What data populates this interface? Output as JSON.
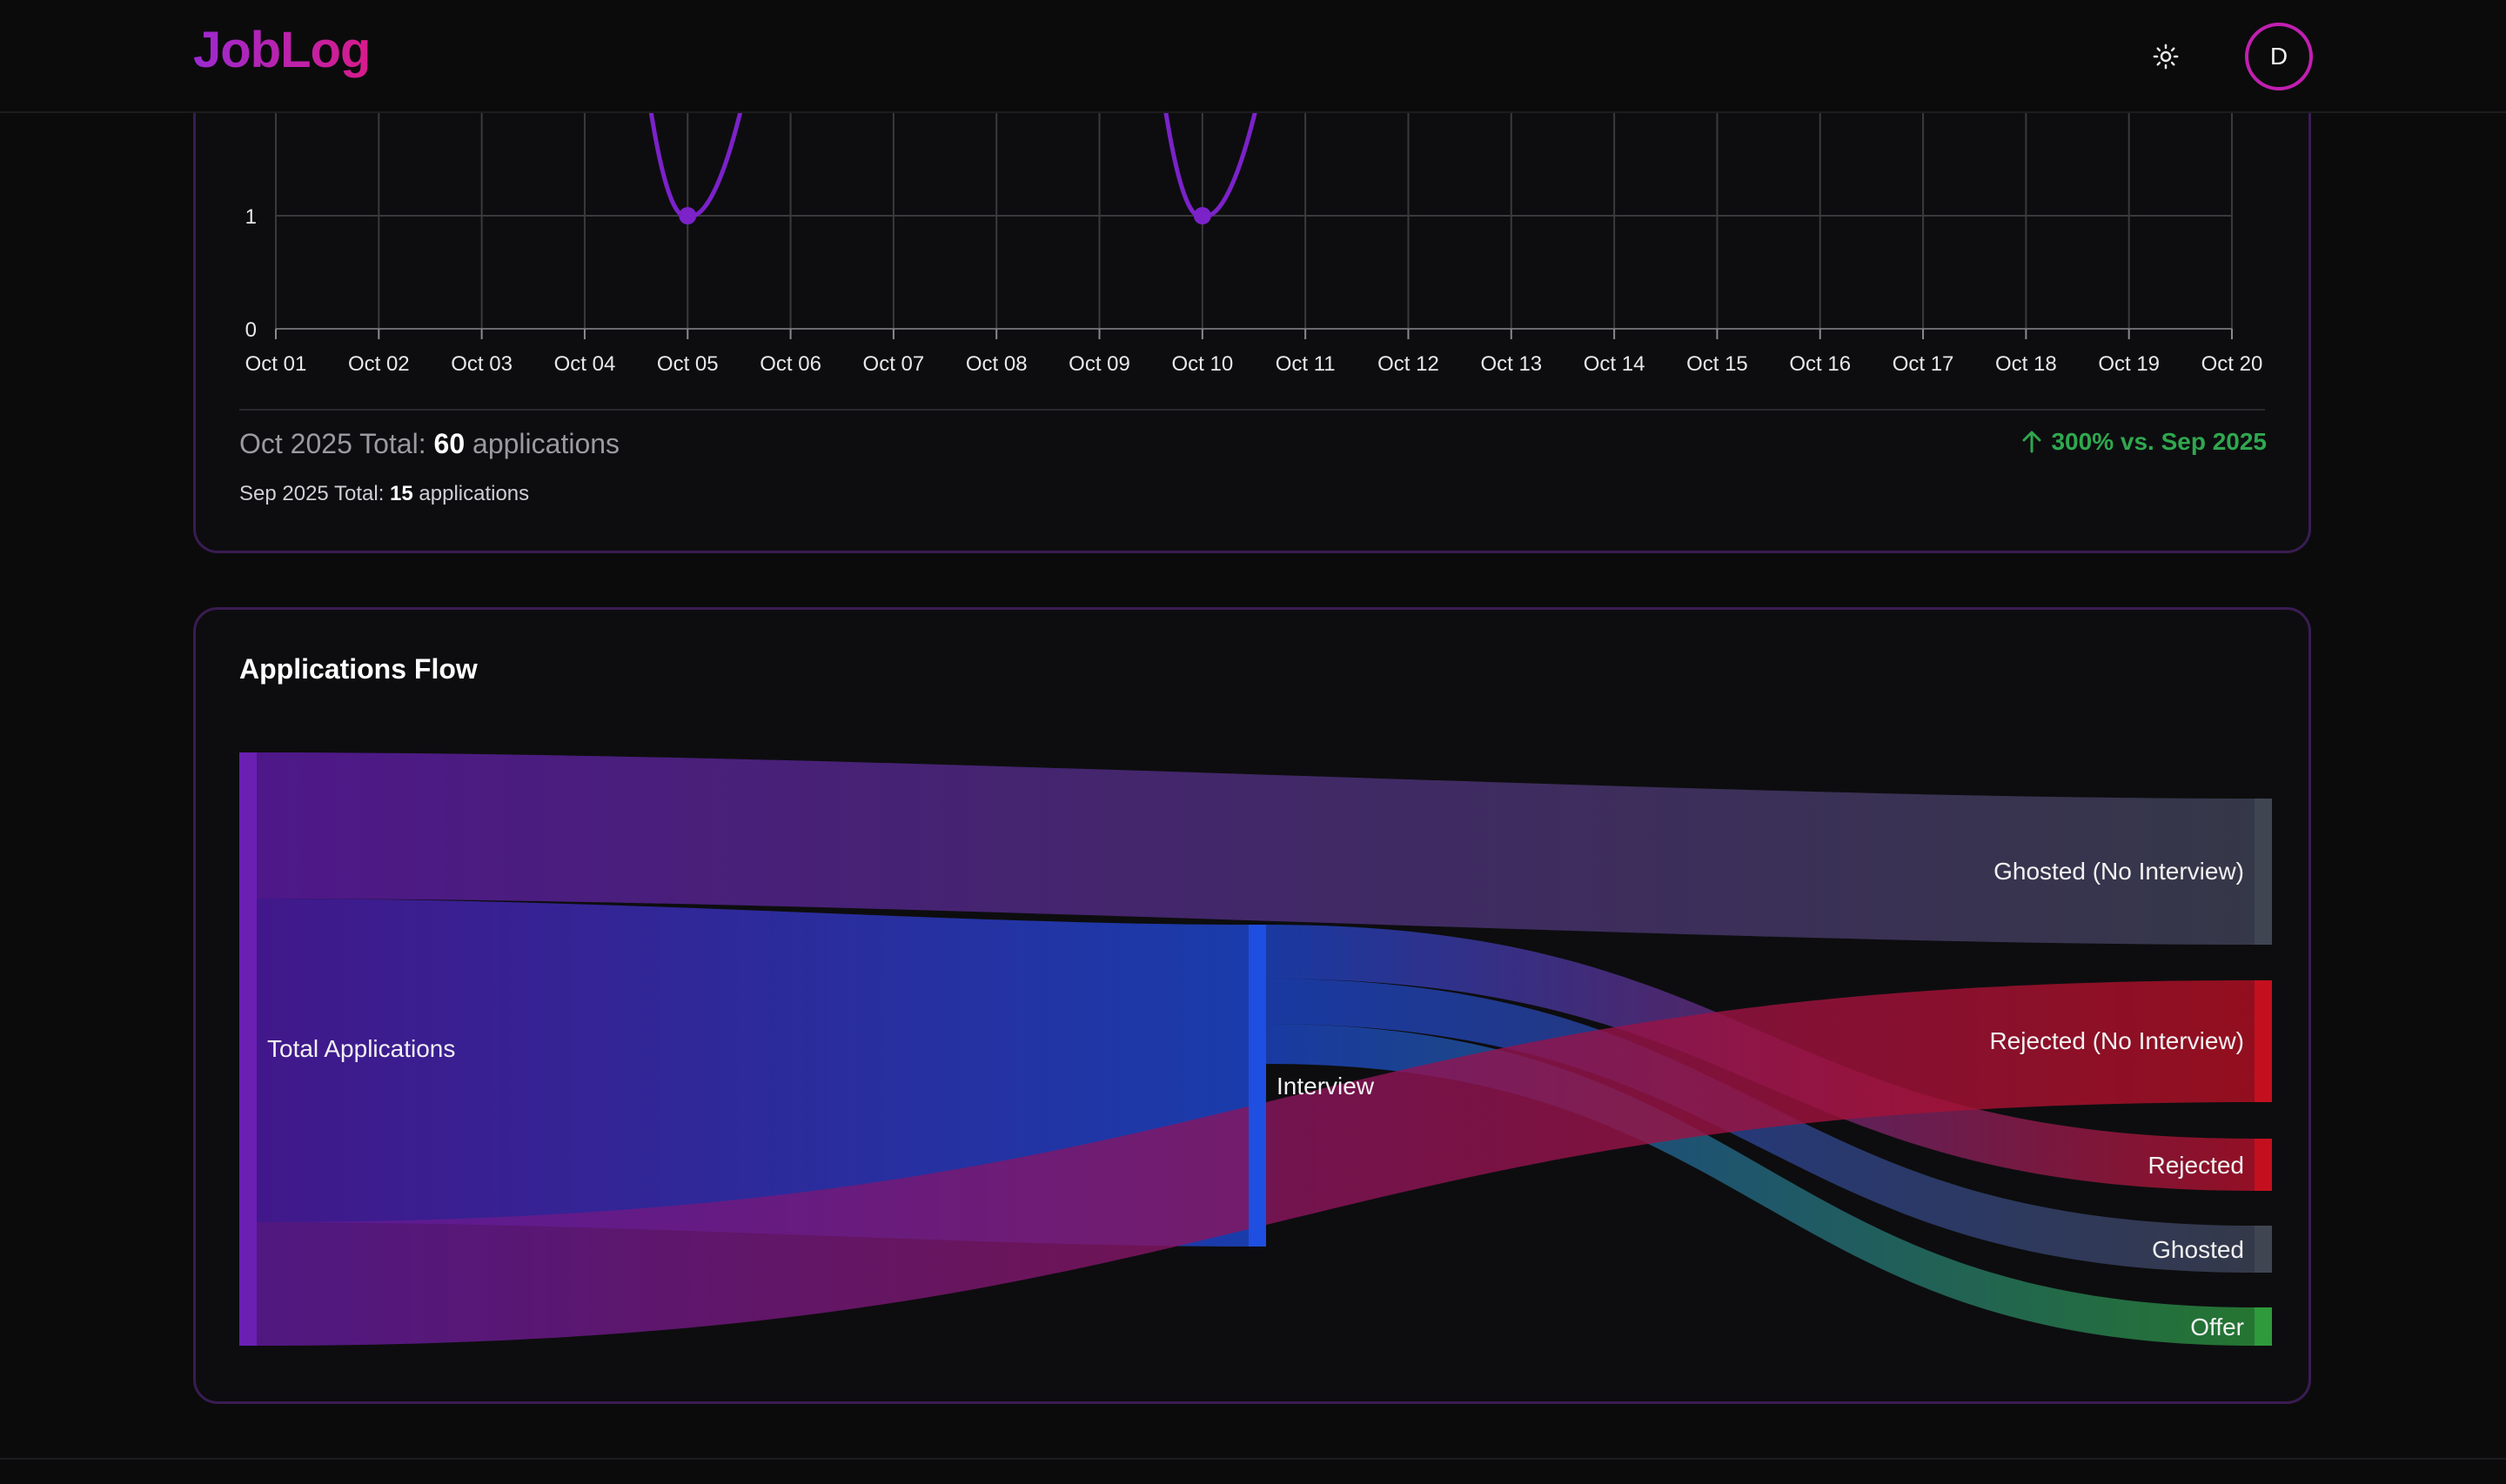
{
  "header": {
    "logo": "JobLog",
    "theme_icon": "sun-icon",
    "avatar_initial": "D"
  },
  "trend": {
    "chart_data": {
      "type": "line",
      "x": [
        "Oct 01",
        "Oct 02",
        "Oct 03",
        "Oct 04",
        "Oct 05",
        "Oct 06",
        "Oct 07",
        "Oct 08",
        "Oct 09",
        "Oct 10",
        "Oct 11",
        "Oct 12",
        "Oct 13",
        "Oct 14",
        "Oct 15",
        "Oct 16",
        "Oct 17",
        "Oct 18",
        "Oct 19",
        "Oct 20"
      ],
      "y_tick_labels": [
        "0",
        "1"
      ],
      "visible_points": [
        {
          "x": "Oct 05",
          "y": 1
        },
        {
          "x": "Oct 10",
          "y": 1
        }
      ],
      "grid": true,
      "series_color": "#7b22c9"
    },
    "current_prefix": "Oct 2025 Total: ",
    "current_total": "60",
    "current_suffix": " applications",
    "previous_prefix": "Sep 2025 Total: ",
    "previous_total": "15",
    "previous_suffix": " applications",
    "change_text": "300% vs. Sep 2025",
    "change_color": "#2fa84f"
  },
  "flow": {
    "title": "Applications Flow",
    "nodes": [
      {
        "id": "total",
        "label": "Total Applications",
        "color": "#6b1fb3"
      },
      {
        "id": "interview",
        "label": "Interview",
        "color": "#1f4fe0"
      },
      {
        "id": "ghosted_ni",
        "label": "Ghosted (No Interview)",
        "color": "#3f4652"
      },
      {
        "id": "rejected_ni",
        "label": "Rejected (No Interview)",
        "color": "#c4101e"
      },
      {
        "id": "rejected",
        "label": "Rejected",
        "color": "#c4101e"
      },
      {
        "id": "ghosted",
        "label": "Ghosted",
        "color": "#3f4652"
      },
      {
        "id": "offer",
        "label": "Offer",
        "color": "#2e9a3c"
      }
    ]
  }
}
